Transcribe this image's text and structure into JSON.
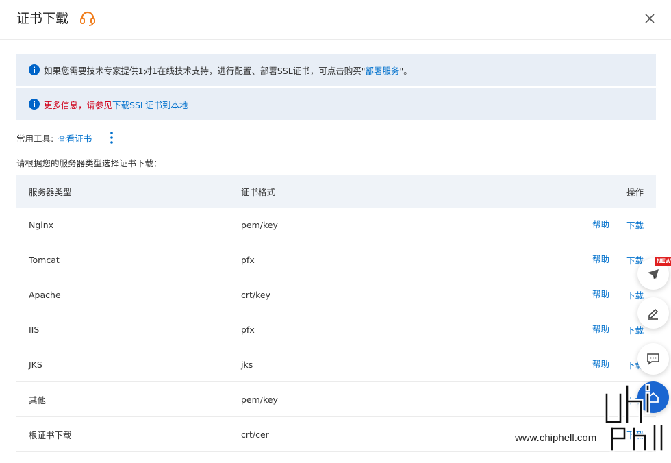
{
  "header": {
    "title": "证书下载"
  },
  "alerts": {
    "alert1": {
      "text": "如果您需要技术专家提供1对1在线技术支持，进行配置、部署SSL证书，可点击购买\"",
      "link": "部署服务",
      "suffix": "\"。"
    },
    "alert2": {
      "red_text": "更多信息，请参见",
      "link": "下载SSL证书到本地"
    }
  },
  "tools": {
    "label": "常用工具:",
    "view_cert": "查看证书"
  },
  "instruction": "请根据您的服务器类型选择证书下载：",
  "table": {
    "headers": {
      "server_type": "服务器类型",
      "format": "证书格式",
      "actions": "操作"
    },
    "rows": [
      {
        "server": "Nginx",
        "format": "pem/key",
        "help": "帮助",
        "download": "下载"
      },
      {
        "server": "Tomcat",
        "format": "pfx",
        "help": "帮助",
        "download": "下载"
      },
      {
        "server": "Apache",
        "format": "crt/key",
        "help": "帮助",
        "download": "下载"
      },
      {
        "server": "IIS",
        "format": "pfx",
        "help": "帮助",
        "download": "下载"
      },
      {
        "server": "JKS",
        "format": "jks",
        "help": "帮助",
        "download": "下载"
      },
      {
        "server": "其他",
        "format": "pem/key",
        "download": "下载"
      },
      {
        "server": "根证书下载",
        "format": "crt/cer",
        "download": "下载"
      }
    ]
  },
  "floating": {
    "new_badge": "NEW"
  },
  "watermark": {
    "text": "www.chiphell.com"
  },
  "colors": {
    "accent": "#0070cc",
    "alert_bg": "#e8eef6",
    "warning_red": "#d0021b",
    "support_orange": "#f07e1e",
    "fab_blue": "#1a66d1"
  },
  "icons": [
    "support-headset-icon",
    "close-icon",
    "info-icon",
    "more-vertical-icon",
    "new-feature-icon",
    "edit-icon",
    "chat-icon",
    "home-icon"
  ]
}
